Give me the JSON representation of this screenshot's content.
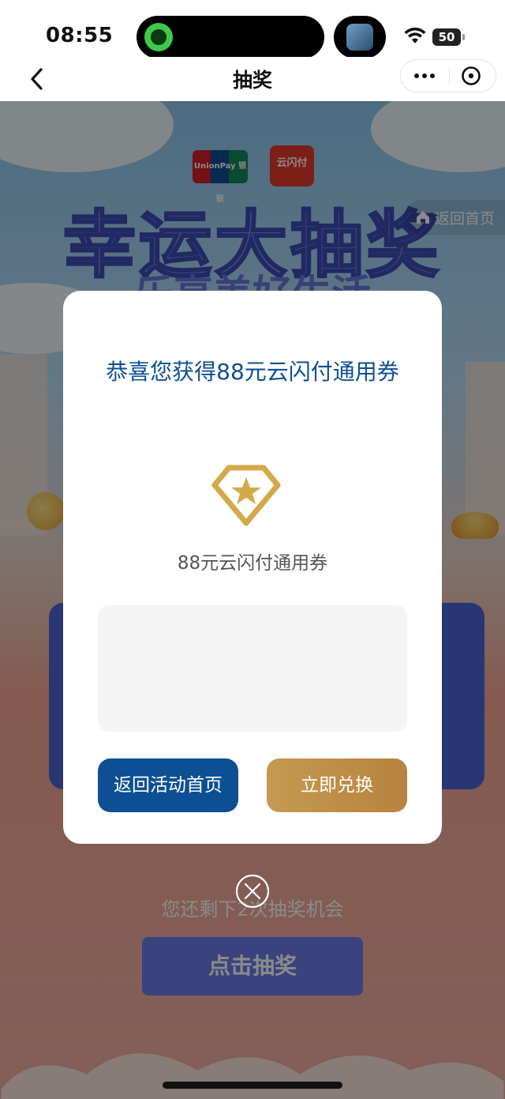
{
  "status_bar": {
    "time": "08:55",
    "battery": "50"
  },
  "nav": {
    "title": "抽奖"
  },
  "background_page": {
    "banner_title": "幸运大抽奖",
    "banner_subtitle": "乐享美好生活",
    "logo_unionpay": "UnionPay 银联",
    "logo_cloudpay": "云闪付",
    "home_link": "返回首页",
    "chances_text": "您还剩下2次抽奖机会",
    "draw_button": "点击抽奖"
  },
  "modal": {
    "title": "恭喜您获得88元云闪付通用券",
    "prize_name": "88元云闪付通用券",
    "back_button": "返回活动首页",
    "redeem_button": "立即兑换"
  },
  "colors": {
    "brand_blue": "#0d4f94",
    "gold": "#c69951",
    "overlay": "rgba(0,0,0,0.46)"
  }
}
